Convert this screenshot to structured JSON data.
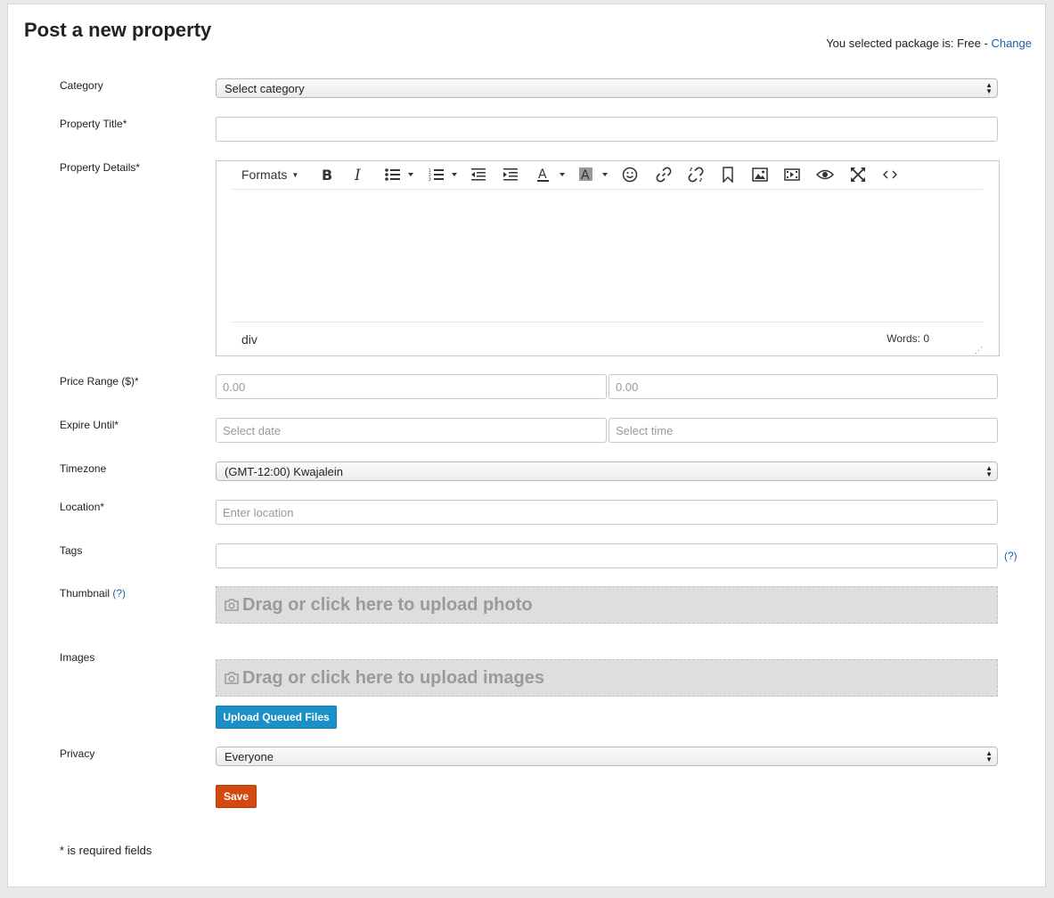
{
  "page": {
    "title": "Post a new property",
    "package_prefix": "You selected package is: Free - ",
    "package_change": "Change",
    "required_note": "* is required fields"
  },
  "form": {
    "category": {
      "label": "Category",
      "value": "Select category"
    },
    "title": {
      "label": "Property Title*",
      "value": ""
    },
    "details": {
      "label": "Property Details*",
      "formats": "Formats",
      "path": "div",
      "word_count": "Words: 0"
    },
    "price": {
      "label": "Price Range ($)*",
      "min_placeholder": "0.00",
      "max_placeholder": "0.00"
    },
    "expire": {
      "label": "Expire Until*",
      "date_placeholder": "Select date",
      "time_placeholder": "Select time"
    },
    "timezone": {
      "label": "Timezone",
      "value": "(GMT-12:00) Kwajalein"
    },
    "location": {
      "label": "Location*",
      "placeholder": "Enter location"
    },
    "tags": {
      "label": "Tags",
      "help": "(?)"
    },
    "thumbnail": {
      "label": "Thumbnail",
      "help": "(?)",
      "drop_text": "Drag or click here to upload photo"
    },
    "images": {
      "label": "Images",
      "drop_text": "Drag or click here to upload images",
      "upload_button": "Upload Queued Files"
    },
    "privacy": {
      "label": "Privacy",
      "value": "Everyone"
    },
    "save_button": "Save"
  },
  "toolbar_icons": [
    "bold-icon",
    "italic-icon",
    "bullet-list-icon",
    "numbered-list-icon",
    "outdent-icon",
    "indent-icon",
    "text-color-icon",
    "background-color-icon",
    "emoticon-icon",
    "link-icon",
    "unlink-icon",
    "bookmark-icon",
    "image-icon",
    "media-icon",
    "preview-icon",
    "fullscreen-icon",
    "source-code-icon"
  ],
  "colors": {
    "link": "#1f5ea8",
    "upload_button": "#1b8fc7",
    "save_button": "#d4490f",
    "dropzone": "#dedede"
  }
}
